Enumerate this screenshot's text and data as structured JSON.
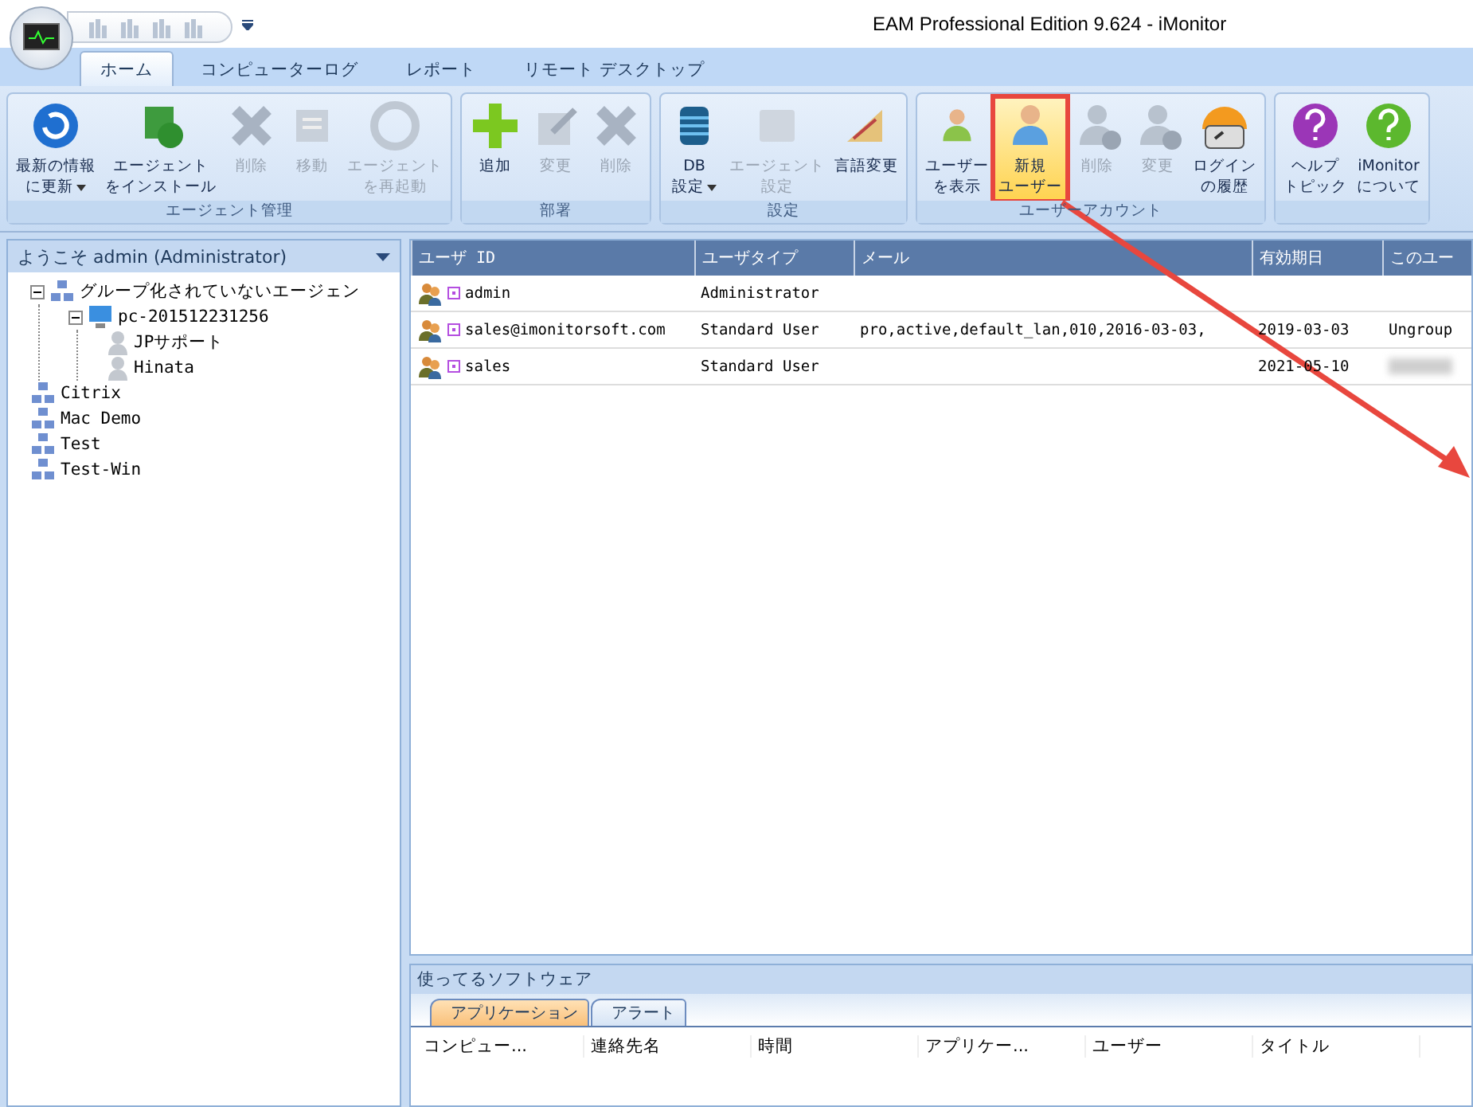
{
  "window": {
    "title": "EAM Professional Edition 9.624 - iMonitor"
  },
  "ribbon_tabs": [
    {
      "label": "ホーム",
      "selected": true
    },
    {
      "label": "コンピューターログ",
      "selected": false
    },
    {
      "label": "レポート",
      "selected": false
    },
    {
      "label": "リモート デスクトップ",
      "selected": false
    }
  ],
  "ribbon_groups": [
    {
      "label": "エージェント管理",
      "buttons": [
        {
          "kind": "refresh",
          "lines": [
            "最新の情報",
            "に更新"
          ],
          "disabled": false,
          "dropdown": true,
          "highlighted": false
        },
        {
          "kind": "install",
          "lines": [
            "エージェント",
            "をインストール"
          ],
          "disabled": false,
          "highlighted": false
        },
        {
          "kind": "delete",
          "lines": [
            "削除"
          ],
          "disabled": true,
          "highlighted": false
        },
        {
          "kind": "move",
          "lines": [
            "移動"
          ],
          "disabled": true,
          "highlighted": false
        },
        {
          "kind": "restart",
          "lines": [
            "エージェント",
            "を再起動"
          ],
          "disabled": true,
          "highlighted": false
        }
      ]
    },
    {
      "label": "部署",
      "buttons": [
        {
          "kind": "add",
          "lines": [
            "追加"
          ],
          "disabled": false,
          "highlighted": false
        },
        {
          "kind": "edit",
          "lines": [
            "変更"
          ],
          "disabled": true,
          "highlighted": false
        },
        {
          "kind": "delete",
          "lines": [
            "削除"
          ],
          "disabled": true,
          "highlighted": false
        }
      ]
    },
    {
      "label": "設定",
      "buttons": [
        {
          "kind": "database",
          "lines": [
            "DB",
            "設定"
          ],
          "disabled": false,
          "dropdown": true,
          "highlighted": false
        },
        {
          "kind": "agent-settings",
          "lines": [
            "エージェント",
            "設定"
          ],
          "disabled": true,
          "highlighted": false
        },
        {
          "kind": "language",
          "lines": [
            "言語変更"
          ],
          "disabled": false,
          "highlighted": false
        }
      ]
    },
    {
      "label": "ユーザーアカウント",
      "buttons": [
        {
          "kind": "users",
          "lines": [
            "ユーザー",
            "を表示"
          ],
          "disabled": false,
          "highlighted": false
        },
        {
          "kind": "user-new",
          "lines": [
            "新規",
            "ユーザー"
          ],
          "disabled": false,
          "highlighted": true
        },
        {
          "kind": "user-delete",
          "lines": [
            "削除"
          ],
          "disabled": true,
          "highlighted": false
        },
        {
          "kind": "user-info",
          "lines": [
            "変更"
          ],
          "disabled": true,
          "highlighted": false
        },
        {
          "kind": "login-history",
          "lines": [
            "ログイン",
            "の履歴"
          ],
          "disabled": false,
          "highlighted": false
        }
      ]
    },
    {
      "buttons": [
        {
          "kind": "help",
          "lines": [
            "ヘルプ",
            "トピック"
          ],
          "disabled": false,
          "highlighted": false
        },
        {
          "kind": "about",
          "lines": [
            "iMonitor",
            "について"
          ],
          "disabled": false,
          "highlighted": false
        }
      ]
    }
  ],
  "sidebar": {
    "title": "ようこそ admin (Administrator)",
    "tree": [
      {
        "kind": "group",
        "label": "グループ化されていないエージェン",
        "expanded": true,
        "children": [
          {
            "kind": "computer",
            "label": "pc-201512231256",
            "expanded": true,
            "children": [
              {
                "kind": "user",
                "label": "JPサポート"
              },
              {
                "kind": "user",
                "label": "Hinata"
              }
            ]
          }
        ]
      },
      {
        "kind": "group",
        "label": "Citrix"
      },
      {
        "kind": "group",
        "label": "Mac Demo"
      },
      {
        "kind": "group",
        "label": "Test"
      },
      {
        "kind": "group",
        "label": "Test-Win"
      }
    ]
  },
  "table": {
    "columns": [
      "ユーザ ID",
      "ユーザタイプ",
      "メール",
      "有効期日",
      "このユー"
    ],
    "rows": [
      {
        "cells": [
          "admin",
          "Administrator",
          "",
          "",
          ""
        ],
        "blurred_last": false
      },
      {
        "cells": [
          "sales@imonitorsoft.com",
          "Standard User",
          "pro,active,default_lan,010,2016-03-03,",
          "2019-03-03",
          "Ungroup"
        ],
        "blurred_last": false
      },
      {
        "cells": [
          "sales",
          "Standard User",
          "",
          "2021-05-10",
          ""
        ],
        "blurred_last": true
      }
    ]
  },
  "bottom_panel": {
    "title": "使ってるソフトウェア",
    "tabs": [
      {
        "label": "アプリケーション",
        "selected": true
      },
      {
        "label": "アラート",
        "selected": false
      }
    ],
    "columns": [
      "コンピュー...",
      "連絡先名",
      "時間",
      "アプリケー...",
      "ユーザー",
      "タイトル"
    ]
  }
}
